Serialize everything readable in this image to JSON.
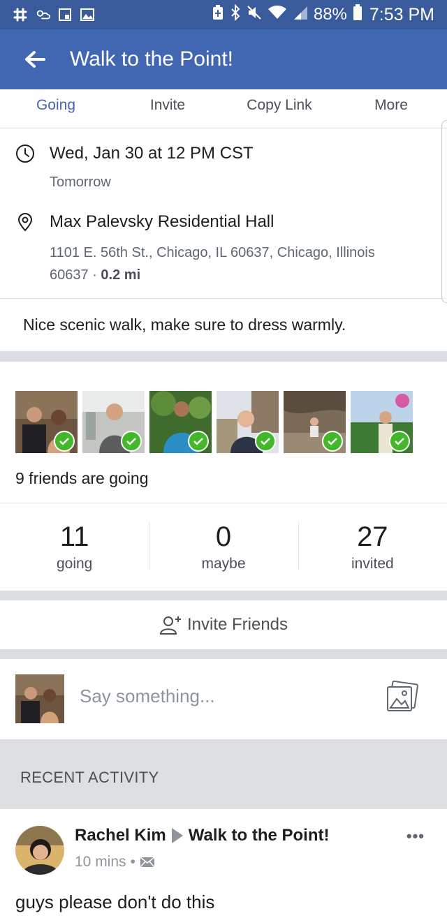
{
  "status_bar": {
    "battery": "88%",
    "time": "7:53 PM"
  },
  "appbar": {
    "title": "Walk to the Point!"
  },
  "tabs": [
    {
      "label": "Going"
    },
    {
      "label": "Invite"
    },
    {
      "label": "Copy Link"
    },
    {
      "label": "More"
    }
  ],
  "event": {
    "date": "Wed, Jan 30 at 12 PM CST",
    "relative": "Tomorrow",
    "location_name": "Max Palevsky Residential Hall",
    "address": "1101 E. 56th St., Chicago, IL 60637, Chicago, Illinois 60637",
    "separator": "·",
    "distance": "0.2 mi",
    "description": "Nice scenic walk, make sure to dress warmly."
  },
  "friends": {
    "text": "9 friends are going"
  },
  "counts": [
    {
      "value": "11",
      "label": "going"
    },
    {
      "value": "0",
      "label": "maybe"
    },
    {
      "value": "27",
      "label": "invited"
    }
  ],
  "invite": {
    "label": "Invite Friends"
  },
  "composer": {
    "placeholder": "Say something..."
  },
  "recent": {
    "title": "RECENT ACTIVITY"
  },
  "post": {
    "author": "Rachel Kim",
    "target": "Walk to the Point!",
    "time": "10 mins",
    "dot": "•",
    "more": "•••",
    "text": "guys please don't do this"
  },
  "colors": {
    "statusbar": "#3a5b9b",
    "appbar": "#4267b2",
    "accent": "#4267b2",
    "check": "#42b72a"
  }
}
